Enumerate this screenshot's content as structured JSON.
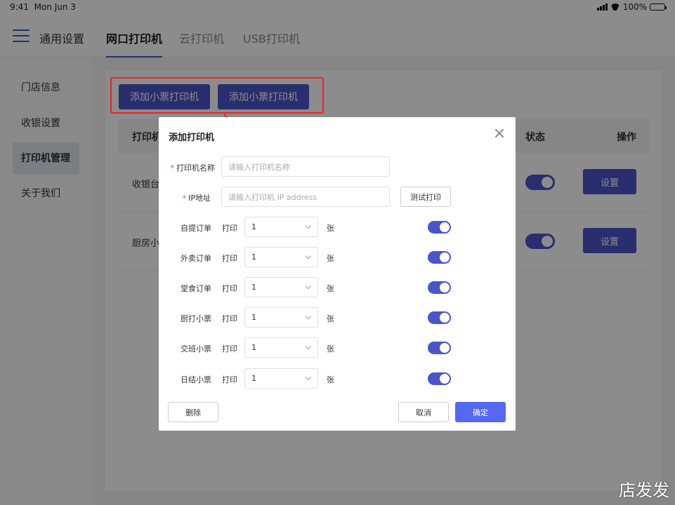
{
  "status_bar": {
    "time": "9:41",
    "date": "Mon Jun 3",
    "battery": "100%"
  },
  "nav": {
    "general_settings": "通用设置",
    "tabs": [
      {
        "label": "网口打印机",
        "active": true
      },
      {
        "label": "云打印机",
        "active": false
      },
      {
        "label": "USB打印机",
        "active": false
      }
    ]
  },
  "sidebar": {
    "items": [
      {
        "label": "门店信息"
      },
      {
        "label": "收银设置"
      },
      {
        "label": "打印机管理",
        "active": true
      },
      {
        "label": "关于我们"
      }
    ]
  },
  "content": {
    "add_buttons": [
      "添加小票打印机",
      "添加小票打印机"
    ],
    "table_headers": {
      "printer": "打印机",
      "status": "状态",
      "action": "操作"
    },
    "rows": [
      {
        "name": "收银台",
        "status_on": true,
        "action": "设置"
      },
      {
        "name": "厨房小票",
        "status_on": true,
        "action": "设置"
      }
    ]
  },
  "modal": {
    "title": "添加打印机",
    "fields": {
      "printer_name": {
        "label": "打印机名称",
        "placeholder": "请输入打印机名称"
      },
      "ip_address": {
        "label": "IP地址",
        "placeholder": "请输入打印机 IP address"
      }
    },
    "test_print": "测试打印",
    "print_word": "打印",
    "unit": "张",
    "print_rows": [
      {
        "label": "自提订单",
        "value": "1",
        "enabled": true
      },
      {
        "label": "外卖订单",
        "value": "1",
        "enabled": true
      },
      {
        "label": "堂食订单",
        "value": "1",
        "enabled": true
      },
      {
        "label": "厨打小票",
        "value": "1",
        "enabled": true
      },
      {
        "label": "交班小票",
        "value": "1",
        "enabled": true
      },
      {
        "label": "日结小票",
        "value": "1",
        "enabled": true
      }
    ],
    "buttons": {
      "delete": "删除",
      "cancel": "取消",
      "confirm": "确定"
    }
  },
  "colors": {
    "primary": "#4a55c8",
    "confirm": "#5468f0",
    "highlight": "#e22222"
  },
  "watermark": "店发发"
}
